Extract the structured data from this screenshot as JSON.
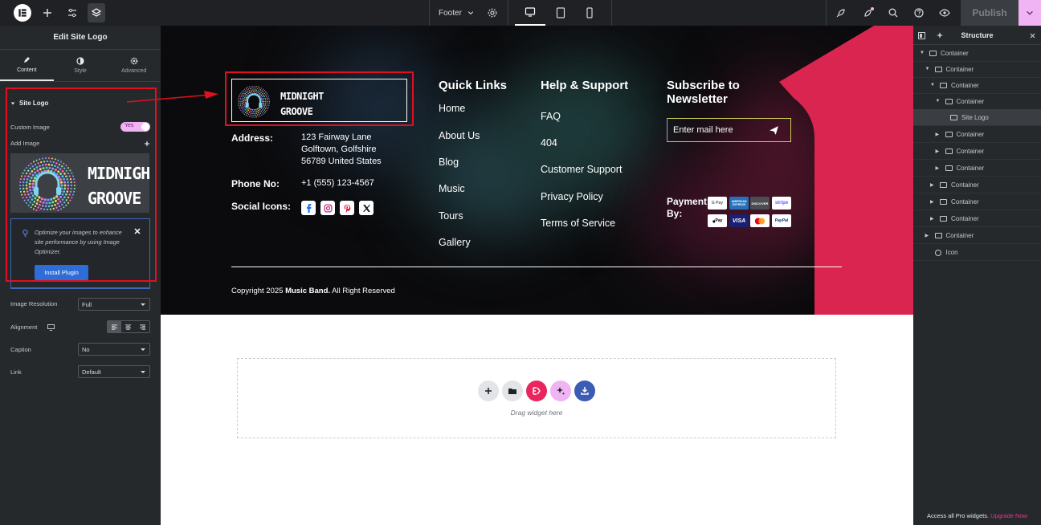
{
  "topbar": {
    "template_name": "Footer",
    "publish_label": "Publish"
  },
  "left_panel": {
    "title": "Edit Site Logo",
    "tabs": [
      {
        "label": "Content"
      },
      {
        "label": "Style"
      },
      {
        "label": "Advanced"
      }
    ],
    "section_title": "Site Logo",
    "custom_image_label": "Custom Image",
    "custom_image_toggle": "Yes",
    "add_image_label": "Add Image",
    "preview_logo_line1": "MIDNIGHT",
    "preview_logo_line2": "GROOVE",
    "optimizer_text": "Optimize your images to enhance site performance by using Image Optimizer.",
    "install_button": "Install Plugin",
    "image_resolution_label": "Image Resolution",
    "image_resolution_value": "Full",
    "alignment_label": "Alignment",
    "caption_label": "Caption",
    "caption_value": "No",
    "link_label": "Link",
    "link_value": "Default"
  },
  "footer": {
    "logo_line1": "MIDNIGHT",
    "logo_line2": "GROOVE",
    "address_label": "Address:",
    "address_lines": [
      "123 Fairway Lane",
      "Golftown, Golfshire",
      "56789 United States"
    ],
    "phone_label": "Phone No:",
    "phone_value": "+1 (555) 123-4567",
    "social_label": "Social Icons:",
    "quick_links_title": "Quick Links",
    "quick_links": [
      "Home",
      "About Us",
      "Blog",
      "Music",
      "Tours",
      "Gallery"
    ],
    "support_title": "Help & Support",
    "support_links": [
      "FAQ",
      "404",
      "Customer Support",
      "Privacy Policy",
      "Terms of Service"
    ],
    "subscribe_title_line1": "Subscribe to",
    "subscribe_title_line2": "Newsletter",
    "email_placeholder": "Enter mail here",
    "payment_label_line1": "Payment",
    "payment_label_line2": "By:",
    "payment_methods_row1": [
      "G Pay",
      "AMERICAN EXPRESS",
      "DISCOVER",
      "stripe"
    ],
    "payment_methods_row2": [
      "Pay",
      "VISA",
      "",
      "PayPal"
    ],
    "copyright_prefix": "Copyright 2025 ",
    "copyright_brand": "Music Band.",
    "copyright_suffix": " All Right Reserved"
  },
  "dropzone": {
    "hint": "Drag widget here"
  },
  "structure": {
    "title": "Structure",
    "nodes": [
      {
        "label": "Container"
      },
      {
        "label": "Container"
      },
      {
        "label": "Container"
      },
      {
        "label": "Container"
      },
      {
        "label": "Site Logo"
      },
      {
        "label": "Container"
      },
      {
        "label": "Container"
      },
      {
        "label": "Container"
      },
      {
        "label": "Container"
      },
      {
        "label": "Container"
      },
      {
        "label": "Container"
      },
      {
        "label": "Container"
      },
      {
        "label": "Icon"
      }
    ],
    "footer_text": "Access all Pro widgets.",
    "footer_link": "Upgrade Now"
  },
  "colors": {
    "accent_pink": "#f0b4f4",
    "brand_red": "#da2550",
    "install_blue": "#2e6cd8",
    "annotation_red": "#e10f1f"
  }
}
